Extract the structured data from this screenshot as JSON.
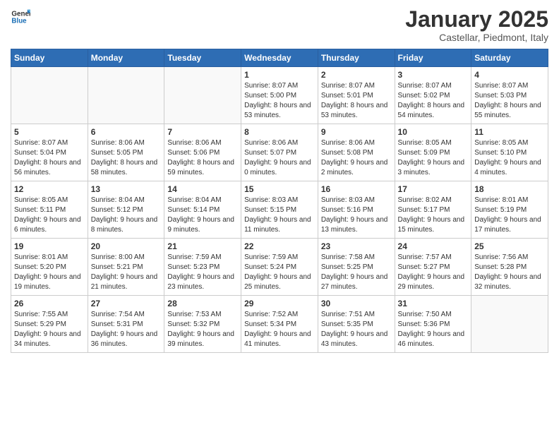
{
  "logo": {
    "line1": "General",
    "line2": "Blue"
  },
  "title": "January 2025",
  "subtitle": "Castellar, Piedmont, Italy",
  "weekdays": [
    "Sunday",
    "Monday",
    "Tuesday",
    "Wednesday",
    "Thursday",
    "Friday",
    "Saturday"
  ],
  "weeks": [
    [
      {
        "day": "",
        "info": ""
      },
      {
        "day": "",
        "info": ""
      },
      {
        "day": "",
        "info": ""
      },
      {
        "day": "1",
        "info": "Sunrise: 8:07 AM\nSunset: 5:00 PM\nDaylight: 8 hours and 53 minutes."
      },
      {
        "day": "2",
        "info": "Sunrise: 8:07 AM\nSunset: 5:01 PM\nDaylight: 8 hours and 53 minutes."
      },
      {
        "day": "3",
        "info": "Sunrise: 8:07 AM\nSunset: 5:02 PM\nDaylight: 8 hours and 54 minutes."
      },
      {
        "day": "4",
        "info": "Sunrise: 8:07 AM\nSunset: 5:03 PM\nDaylight: 8 hours and 55 minutes."
      }
    ],
    [
      {
        "day": "5",
        "info": "Sunrise: 8:07 AM\nSunset: 5:04 PM\nDaylight: 8 hours and 56 minutes."
      },
      {
        "day": "6",
        "info": "Sunrise: 8:06 AM\nSunset: 5:05 PM\nDaylight: 8 hours and 58 minutes."
      },
      {
        "day": "7",
        "info": "Sunrise: 8:06 AM\nSunset: 5:06 PM\nDaylight: 8 hours and 59 minutes."
      },
      {
        "day": "8",
        "info": "Sunrise: 8:06 AM\nSunset: 5:07 PM\nDaylight: 9 hours and 0 minutes."
      },
      {
        "day": "9",
        "info": "Sunrise: 8:06 AM\nSunset: 5:08 PM\nDaylight: 9 hours and 2 minutes."
      },
      {
        "day": "10",
        "info": "Sunrise: 8:05 AM\nSunset: 5:09 PM\nDaylight: 9 hours and 3 minutes."
      },
      {
        "day": "11",
        "info": "Sunrise: 8:05 AM\nSunset: 5:10 PM\nDaylight: 9 hours and 4 minutes."
      }
    ],
    [
      {
        "day": "12",
        "info": "Sunrise: 8:05 AM\nSunset: 5:11 PM\nDaylight: 9 hours and 6 minutes."
      },
      {
        "day": "13",
        "info": "Sunrise: 8:04 AM\nSunset: 5:12 PM\nDaylight: 9 hours and 8 minutes."
      },
      {
        "day": "14",
        "info": "Sunrise: 8:04 AM\nSunset: 5:14 PM\nDaylight: 9 hours and 9 minutes."
      },
      {
        "day": "15",
        "info": "Sunrise: 8:03 AM\nSunset: 5:15 PM\nDaylight: 9 hours and 11 minutes."
      },
      {
        "day": "16",
        "info": "Sunrise: 8:03 AM\nSunset: 5:16 PM\nDaylight: 9 hours and 13 minutes."
      },
      {
        "day": "17",
        "info": "Sunrise: 8:02 AM\nSunset: 5:17 PM\nDaylight: 9 hours and 15 minutes."
      },
      {
        "day": "18",
        "info": "Sunrise: 8:01 AM\nSunset: 5:19 PM\nDaylight: 9 hours and 17 minutes."
      }
    ],
    [
      {
        "day": "19",
        "info": "Sunrise: 8:01 AM\nSunset: 5:20 PM\nDaylight: 9 hours and 19 minutes."
      },
      {
        "day": "20",
        "info": "Sunrise: 8:00 AM\nSunset: 5:21 PM\nDaylight: 9 hours and 21 minutes."
      },
      {
        "day": "21",
        "info": "Sunrise: 7:59 AM\nSunset: 5:23 PM\nDaylight: 9 hours and 23 minutes."
      },
      {
        "day": "22",
        "info": "Sunrise: 7:59 AM\nSunset: 5:24 PM\nDaylight: 9 hours and 25 minutes."
      },
      {
        "day": "23",
        "info": "Sunrise: 7:58 AM\nSunset: 5:25 PM\nDaylight: 9 hours and 27 minutes."
      },
      {
        "day": "24",
        "info": "Sunrise: 7:57 AM\nSunset: 5:27 PM\nDaylight: 9 hours and 29 minutes."
      },
      {
        "day": "25",
        "info": "Sunrise: 7:56 AM\nSunset: 5:28 PM\nDaylight: 9 hours and 32 minutes."
      }
    ],
    [
      {
        "day": "26",
        "info": "Sunrise: 7:55 AM\nSunset: 5:29 PM\nDaylight: 9 hours and 34 minutes."
      },
      {
        "day": "27",
        "info": "Sunrise: 7:54 AM\nSunset: 5:31 PM\nDaylight: 9 hours and 36 minutes."
      },
      {
        "day": "28",
        "info": "Sunrise: 7:53 AM\nSunset: 5:32 PM\nDaylight: 9 hours and 39 minutes."
      },
      {
        "day": "29",
        "info": "Sunrise: 7:52 AM\nSunset: 5:34 PM\nDaylight: 9 hours and 41 minutes."
      },
      {
        "day": "30",
        "info": "Sunrise: 7:51 AM\nSunset: 5:35 PM\nDaylight: 9 hours and 43 minutes."
      },
      {
        "day": "31",
        "info": "Sunrise: 7:50 AM\nSunset: 5:36 PM\nDaylight: 9 hours and 46 minutes."
      },
      {
        "day": "",
        "info": ""
      }
    ]
  ]
}
